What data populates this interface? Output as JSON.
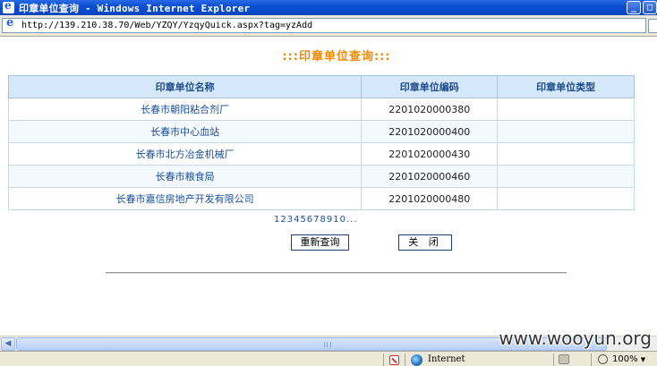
{
  "window": {
    "title": "印章单位查询 - Windows Internet Explorer",
    "buttons": [
      "_",
      "□"
    ]
  },
  "address": {
    "url": "http://139.210.38.70/Web/YZQY/YzqyQuick.aspx?tag=yzAdd",
    "icon": "ie-page-icon"
  },
  "page": {
    "title": ":::印章单位查询:::",
    "table": {
      "headers": [
        "印章单位名称",
        "印章单位编码",
        "印章单位类型"
      ],
      "rows": [
        {
          "name": "长春市朝阳粘合剂厂",
          "code": "2201020000380",
          "type": ""
        },
        {
          "name": "长春市中心血站",
          "code": "2201020000400",
          "type": ""
        },
        {
          "name": "长春市北方冶金机械厂",
          "code": "2201020000430",
          "type": ""
        },
        {
          "name": "长春市粮食局",
          "code": "2201020000460",
          "type": ""
        },
        {
          "name": "长春市嘉信房地产开发有限公司",
          "code": "2201020000480",
          "type": ""
        }
      ]
    },
    "pager": "12345678910...",
    "buttons": {
      "requery": "重新查询",
      "close": "关 闭"
    }
  },
  "scrollbar": {
    "left_arrow": "◀"
  },
  "status": {
    "zone": "Internet",
    "zoom": "100%",
    "zoom_arrow": "▼"
  },
  "watermark": "www.wooyun.org",
  "colors": {
    "title_orange": "#f08800",
    "link_blue": "#1a4f9a",
    "header_bg": "#d6e8fb"
  }
}
